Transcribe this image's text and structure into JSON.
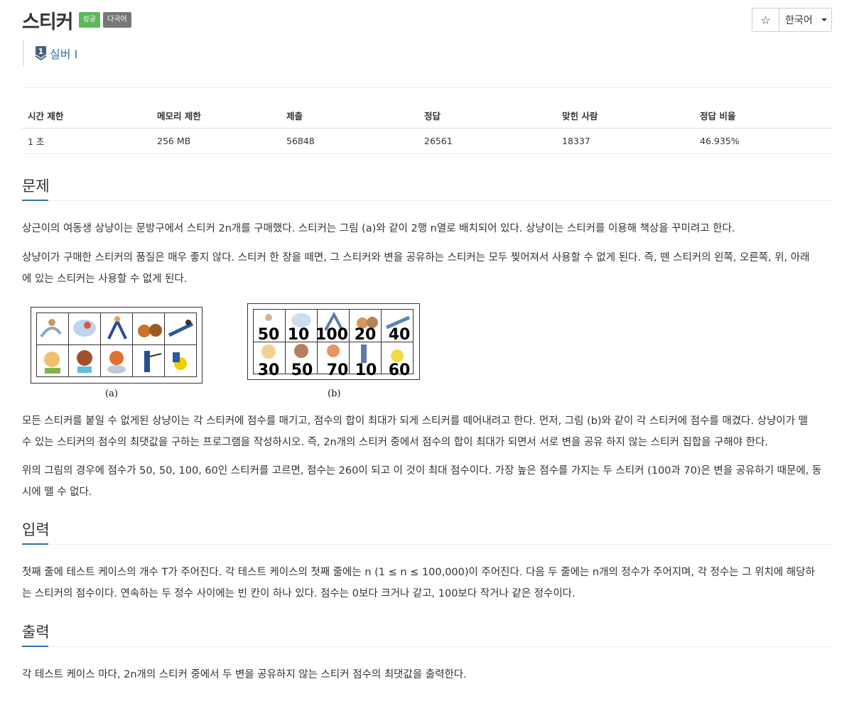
{
  "problem": {
    "title": "스티커",
    "badges": {
      "success": "성공",
      "multilang": "다국어"
    },
    "tier": "실버 I"
  },
  "buttons": {
    "star": "☆",
    "language": "한국어"
  },
  "info_table": {
    "headers": [
      "시간 제한",
      "메모리 제한",
      "제출",
      "정답",
      "맞힌 사람",
      "정답 비율"
    ],
    "values": [
      "1 초",
      "256 MB",
      "56848",
      "26561",
      "18337",
      "46.935%"
    ]
  },
  "sections": {
    "description": {
      "title": "문제",
      "p1": "상근이의 여동생 상냥이는 문방구에서 스티커 2n개를 구매했다. 스티커는 그림 (a)와 같이 2행 n열로 배치되어 있다. 상냥이는 스티커를 이용해 책상을 꾸미려고 한다.",
      "p2a": "상냥이가 구매한 스티커의 품질은 매우 좋지 않다. 스티커 한 장을 떼면, 그 스티커와 변을 공유하는 스티커는 모두 찢어져서 사용할 수 없게 된다. 즉, 뗀 스티커의 왼쪽, 오른쪽, 위, 아래",
      "p2b": "에 있는 스티커는 사용할 수 없게 된다.",
      "p3a": "모든 스티커를 붙일 수 없게된 상냥이는 각 스티커에 점수를 매기고, 점수의 합이 최대가 되게 스티커를 떼어내려고 한다. 먼저, 그림 (b)와 같이 각 스티커에 점수를 매겼다. 상냥이가 뗄",
      "p3b": "수 있는 스티커의 점수의 최댓값을 구하는 프로그램을 작성하시오. 즉, 2n개의 스티커 중에서 점수의 합이 최대가 되면서 서로 변을 공유 하지 않는 스티커 집합을 구해야 한다.",
      "p4a": "위의 그림의 경우에 점수가 50, 50, 100, 60인 스티커를 고르면, 점수는 260이 되고 이 것이 최대 점수이다. 가장 높은 점수를 가지는 두 스티커 (100과 70)은 변을 공유하기 때문에, 동",
      "p4b": "시에 뗄 수 없다."
    },
    "input": {
      "title": "입력",
      "p1a": "첫째 줄에 테스트 케이스의 개수 T가 주어진다. 각 테스트 케이스의 첫째 줄에는 n (1 ≤ n ≤ 100,000)이 주어진다. 다음 두 줄에는 n개의 정수가 주어지며, 각 정수는 그 위치에 해당하",
      "p1b": "는 스티커의 점수이다. 연속하는 두 정수 사이에는 빈 칸이 하나 있다. 점수는 0보다 크거나 같고, 100보다 작거나 같은 정수이다."
    },
    "output": {
      "title": "출력",
      "p1": "각 테스트 케이스 마다, 2n개의 스티커 중에서 두 변을 공유하지 않는 스티커 점수의 최댓값을 출력한다."
    }
  },
  "figure": {
    "caption_a": "(a)",
    "caption_b": "(b)",
    "scores_top": [
      "50",
      "10",
      "100",
      "20",
      "40"
    ],
    "scores_bottom": [
      "30",
      "50",
      "70",
      "10",
      "60"
    ]
  },
  "colors": {
    "success": "#5cb85c",
    "multilang": "#777777",
    "accent": "#2f6fa8"
  }
}
